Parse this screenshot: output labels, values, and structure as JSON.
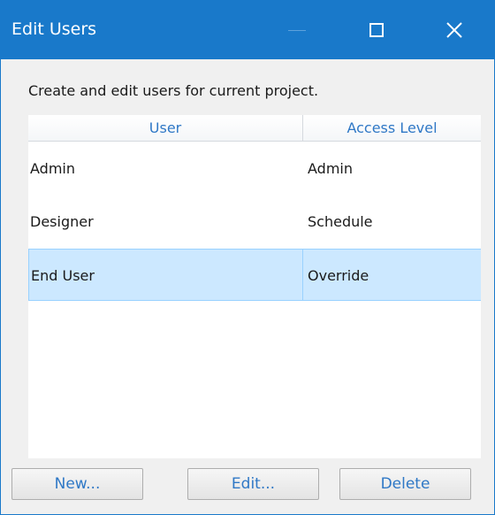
{
  "window": {
    "title": "Edit Users",
    "accent_color": "#1979ca",
    "controls": {
      "minimize_icon": "minimize-icon",
      "maximize_icon": "maximize-icon",
      "close_icon": "close-icon",
      "close_glyph": "✕"
    }
  },
  "description": "Create and edit users for current project.",
  "table": {
    "columns": [
      "User",
      "Access Level"
    ],
    "rows": [
      {
        "user": "Admin",
        "access": "Admin"
      },
      {
        "user": "Designer",
        "access": "Schedule"
      },
      {
        "user": "End User",
        "access": "Override"
      }
    ],
    "selected_row": 2,
    "selection_color": "#cce8ff"
  },
  "buttons": {
    "new_label": "New...",
    "edit_label": "Edit...",
    "delete_label": "Delete"
  }
}
